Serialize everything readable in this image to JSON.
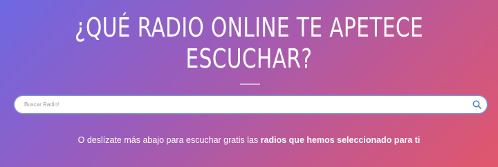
{
  "hero": {
    "headline_line1": "¿QUÉ RADIO ONLINE TE APETECE",
    "headline_line2": "ESCUCHAR?"
  },
  "search": {
    "placeholder": "Buscar Radio!",
    "value": "",
    "icon": "search-icon"
  },
  "tagline": {
    "text": "O deslízate más abajo para escuchar gratis las ",
    "highlight": "radios que hemos seleccionado para ti"
  },
  "colors": {
    "gradient_start": "#6e68e4",
    "gradient_end": "#e1566c",
    "search_border": "#7f8fd6",
    "icon": "#4a7fc1"
  }
}
